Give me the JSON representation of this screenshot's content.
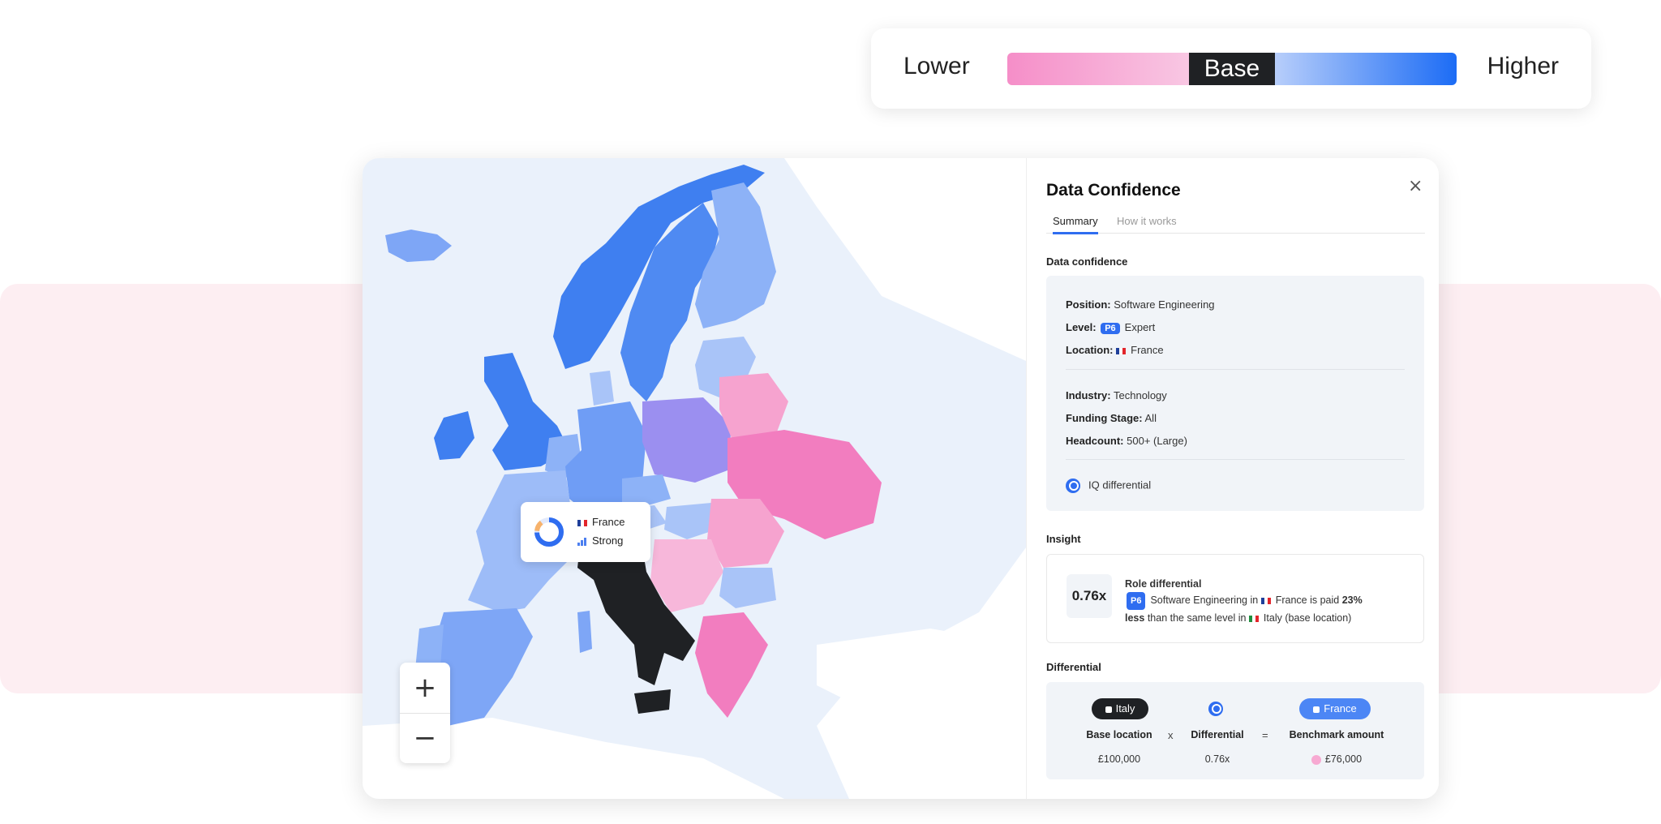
{
  "legend": {
    "lower": "Lower",
    "base": "Base",
    "higher": "Higher"
  },
  "tooltip": {
    "country": "France",
    "confidence": "Strong"
  },
  "panel": {
    "title": "Data Confidence",
    "tabs": [
      "Summary",
      "How it works"
    ],
    "section_confidence": "Data confidence",
    "position_label": "Position:",
    "position_value": "Software Engineering",
    "level_label": "Level:",
    "level_chip": "P6",
    "level_value": "Expert",
    "location_label": "Location:",
    "location_value": "France",
    "industry_label": "Industry:",
    "industry_value": "Technology",
    "funding_label": "Funding Stage:",
    "funding_value": "All",
    "headcount_label": "Headcount:",
    "headcount_value": "500+ (Large)",
    "iq_label": "IQ differential",
    "section_insight": "Insight",
    "insight_value": "0.76x",
    "insight_title": "Role differential",
    "insight_chip": "P6",
    "insight_text_1": "Software Engineering in",
    "insight_country": "France",
    "insight_text_2": "is paid",
    "insight_pct": "23%",
    "insight_less": "less",
    "insight_text_3": "than the same level in",
    "insight_base_country": "Italy",
    "insight_text_4": "(base location)",
    "section_differential": "Differential",
    "pill_base": "Italy",
    "pill_bench": "France",
    "label_base": "Base location",
    "label_diff": "Differential",
    "label_bench": "Benchmark amount",
    "op_mult": "x",
    "op_eq": "=",
    "value_base": "£100,000",
    "value_diff": "0.76x",
    "value_bench": "£76,000"
  },
  "zoom": {
    "plus": "+",
    "minus": "−"
  },
  "icons": {
    "close": "×"
  },
  "colors": {
    "accent": "#2f6df0",
    "base_country": "#1f2124",
    "higher": "#1c6cf5",
    "lower": "#f58ec8"
  }
}
